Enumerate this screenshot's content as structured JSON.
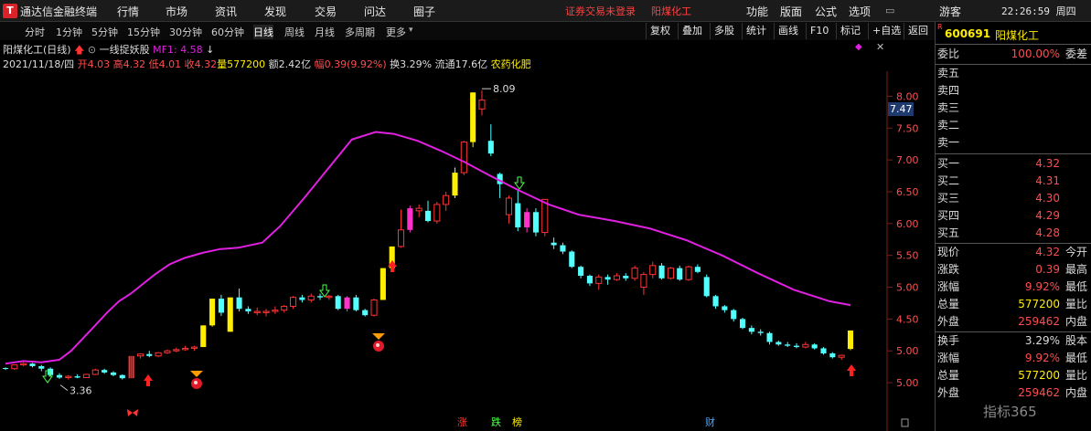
{
  "topbar": {
    "logo": "T",
    "app_title": "通达信金融终端",
    "menu": [
      "行情",
      "市场",
      "资讯",
      "发现",
      "交易",
      "问达",
      "圈子"
    ],
    "notice": "证券交易未登录",
    "notice_stock": "阳煤化工",
    "right_menu": [
      "功能",
      "版面",
      "公式",
      "选项"
    ],
    "guest": "游客",
    "clock": "22:26:59 周四"
  },
  "periods": [
    "分时",
    "1分钟",
    "5分钟",
    "15分钟",
    "30分钟",
    "60分钟",
    "日线",
    "周线",
    "月线",
    "多周期",
    "更多"
  ],
  "active_period": "日线",
  "toolbar": [
    "复权",
    "叠加",
    "多股",
    "统计",
    "画线",
    "F10",
    "标记",
    "+自选",
    "返回"
  ],
  "title": {
    "name": "阳煤化工(日线)",
    "indicator": "一线捉妖股",
    "mf_label": "MF1: 4.58"
  },
  "info": {
    "date": "2021/11/18/四",
    "open": "开4.03",
    "high": "高4.32",
    "low": "低4.01",
    "close": "收4.32",
    "vol_label": "量",
    "vol": "577200",
    "amount": "额2.42亿",
    "change_label": "幅",
    "change": "0.39(9.92%)",
    "turnover": "换3.29%",
    "float": "流通17.6亿",
    "sector": "农药化肥"
  },
  "chart_data": {
    "type": "candlestick",
    "y_ticks": [
      "8.00",
      "7.50",
      "7.00",
      "6.50",
      "6.00",
      "5.50",
      "5.00",
      "4.50",
      "5.00",
      "5.00"
    ],
    "ylim": [
      3.2,
      8.25
    ],
    "high_label": "8.09",
    "low_label": "3.36",
    "price_box": "7.47",
    "bottom_markers": [
      "涨",
      "跌",
      "榜",
      "财"
    ],
    "colors": {
      "up": "#ff3333",
      "down": "#54ffff",
      "limit": "#ffee00",
      "strong": "#ff33cc",
      "ma": "#e020e0"
    },
    "candles": [
      [
        3.72,
        3.74,
        3.7,
        3.73,
        "d"
      ],
      [
        3.72,
        3.79,
        3.7,
        3.78,
        "u"
      ],
      [
        3.78,
        3.82,
        3.76,
        3.8,
        "u"
      ],
      [
        3.8,
        3.81,
        3.74,
        3.76,
        "d"
      ],
      [
        3.76,
        3.78,
        3.68,
        3.72,
        "d"
      ],
      [
        3.72,
        3.74,
        3.6,
        3.62,
        "d"
      ],
      [
        3.62,
        3.65,
        3.56,
        3.58,
        "d"
      ],
      [
        3.58,
        3.62,
        3.55,
        3.6,
        "u"
      ],
      [
        3.6,
        3.63,
        3.57,
        3.58,
        "d"
      ],
      [
        3.58,
        3.64,
        3.58,
        3.63,
        "u"
      ],
      [
        3.63,
        3.72,
        3.62,
        3.7,
        "u"
      ],
      [
        3.7,
        3.72,
        3.64,
        3.66,
        "d"
      ],
      [
        3.66,
        3.68,
        3.6,
        3.62,
        "d"
      ],
      [
        3.62,
        3.63,
        3.55,
        3.57,
        "d"
      ],
      [
        3.57,
        3.92,
        3.57,
        3.92,
        "r"
      ],
      [
        3.92,
        3.96,
        3.88,
        3.95,
        "u"
      ],
      [
        3.95,
        4.0,
        3.9,
        3.92,
        "d"
      ],
      [
        3.92,
        3.98,
        3.9,
        3.97,
        "u"
      ],
      [
        3.97,
        4.02,
        3.95,
        4.0,
        "u"
      ],
      [
        4.0,
        4.05,
        3.98,
        4.02,
        "u"
      ],
      [
        4.02,
        4.08,
        4.0,
        4.04,
        "u"
      ],
      [
        4.04,
        4.08,
        4.0,
        4.06,
        "u"
      ],
      [
        4.06,
        4.4,
        4.06,
        4.4,
        "y"
      ],
      [
        4.4,
        4.82,
        4.38,
        4.82,
        "y"
      ],
      [
        4.82,
        4.88,
        4.55,
        4.6,
        "d"
      ],
      [
        4.3,
        4.84,
        4.3,
        4.84,
        "y"
      ],
      [
        4.84,
        4.98,
        4.62,
        4.66,
        "d"
      ],
      [
        4.66,
        4.7,
        4.58,
        4.62,
        "d"
      ],
      [
        4.62,
        4.68,
        4.56,
        4.6,
        "u"
      ],
      [
        4.6,
        4.66,
        4.54,
        4.62,
        "u"
      ],
      [
        4.62,
        4.7,
        4.58,
        4.64,
        "u"
      ],
      [
        4.64,
        4.72,
        4.6,
        4.7,
        "u"
      ],
      [
        4.7,
        4.86,
        4.66,
        4.84,
        "u"
      ],
      [
        4.84,
        4.88,
        4.76,
        4.8,
        "d"
      ],
      [
        4.8,
        4.9,
        4.76,
        4.86,
        "u"
      ],
      [
        4.86,
        4.9,
        4.8,
        4.84,
        "d"
      ],
      [
        4.84,
        4.88,
        4.8,
        4.86,
        "u"
      ],
      [
        4.86,
        4.88,
        4.64,
        4.66,
        "d"
      ],
      [
        4.66,
        4.86,
        4.62,
        4.84,
        "p"
      ],
      [
        4.84,
        4.88,
        4.62,
        4.64,
        "d"
      ],
      [
        4.64,
        4.66,
        4.54,
        4.56,
        "d"
      ],
      [
        4.56,
        4.82,
        4.54,
        4.8,
        "u"
      ],
      [
        4.8,
        5.3,
        4.8,
        5.3,
        "y"
      ],
      [
        5.3,
        5.64,
        5.3,
        5.64,
        "y"
      ],
      [
        5.64,
        6.22,
        5.62,
        5.9,
        "u"
      ],
      [
        5.9,
        6.28,
        5.86,
        6.24,
        "p"
      ],
      [
        6.24,
        6.3,
        6.1,
        6.2,
        "u"
      ],
      [
        6.2,
        6.36,
        6.02,
        6.04,
        "d"
      ],
      [
        6.04,
        6.34,
        6.0,
        6.3,
        "u"
      ],
      [
        6.3,
        6.5,
        6.2,
        6.44,
        "u"
      ],
      [
        6.44,
        6.88,
        6.4,
        6.8,
        "y"
      ],
      [
        6.8,
        7.3,
        6.76,
        7.28,
        "u"
      ],
      [
        7.28,
        8.06,
        7.2,
        8.06,
        "y"
      ],
      [
        7.94,
        8.09,
        7.7,
        7.8,
        "u"
      ],
      [
        7.3,
        7.56,
        7.06,
        7.1,
        "d"
      ],
      [
        6.78,
        6.8,
        6.4,
        6.62,
        "d"
      ],
      [
        6.4,
        6.44,
        6.0,
        6.14,
        "u"
      ],
      [
        6.32,
        6.52,
        5.88,
        5.94,
        "d"
      ],
      [
        5.94,
        6.24,
        5.86,
        6.18,
        "p"
      ],
      [
        6.18,
        6.24,
        5.8,
        5.86,
        "d"
      ],
      [
        5.86,
        6.38,
        5.8,
        6.38,
        "u"
      ],
      [
        5.7,
        5.78,
        5.6,
        5.66,
        "d"
      ],
      [
        5.66,
        5.7,
        5.52,
        5.56,
        "d"
      ],
      [
        5.56,
        5.58,
        5.3,
        5.32,
        "d"
      ],
      [
        5.32,
        5.34,
        5.14,
        5.18,
        "d"
      ],
      [
        5.18,
        5.2,
        5.02,
        5.06,
        "d"
      ],
      [
        5.06,
        5.2,
        4.96,
        5.16,
        "u"
      ],
      [
        5.16,
        5.2,
        5.04,
        5.12,
        "d"
      ],
      [
        5.12,
        5.22,
        5.1,
        5.18,
        "u"
      ],
      [
        5.18,
        5.22,
        5.1,
        5.14,
        "d"
      ],
      [
        5.14,
        5.34,
        5.1,
        5.3,
        "u"
      ],
      [
        5.0,
        5.24,
        4.88,
        5.2,
        "u"
      ],
      [
        5.2,
        5.4,
        5.14,
        5.34,
        "u"
      ],
      [
        5.34,
        5.38,
        5.12,
        5.14,
        "d"
      ],
      [
        5.14,
        5.32,
        5.12,
        5.3,
        "u"
      ],
      [
        5.3,
        5.34,
        5.1,
        5.12,
        "d"
      ],
      [
        5.12,
        5.34,
        5.1,
        5.32,
        "u"
      ],
      [
        5.32,
        5.36,
        5.22,
        5.24,
        "d"
      ],
      [
        5.16,
        5.2,
        4.84,
        4.86,
        "d"
      ],
      [
        4.86,
        4.88,
        4.66,
        4.7,
        "d"
      ],
      [
        4.7,
        4.72,
        4.6,
        4.64,
        "d"
      ],
      [
        4.64,
        4.66,
        4.46,
        4.5,
        "d"
      ],
      [
        4.5,
        4.52,
        4.34,
        4.36,
        "d"
      ],
      [
        4.36,
        4.4,
        4.26,
        4.3,
        "d"
      ],
      [
        4.3,
        4.34,
        4.24,
        4.28,
        "d"
      ],
      [
        4.28,
        4.3,
        4.1,
        4.14,
        "d"
      ],
      [
        4.14,
        4.16,
        4.08,
        4.1,
        "d"
      ],
      [
        4.1,
        4.14,
        4.06,
        4.08,
        "d"
      ],
      [
        4.08,
        4.12,
        4.04,
        4.06,
        "d"
      ],
      [
        4.06,
        4.14,
        4.04,
        4.1,
        "u"
      ],
      [
        4.1,
        4.12,
        4.02,
        4.04,
        "d"
      ],
      [
        4.04,
        4.06,
        3.94,
        3.96,
        "d"
      ],
      [
        3.96,
        3.98,
        3.88,
        3.9,
        "d"
      ],
      [
        3.9,
        3.94,
        3.86,
        3.93,
        "u"
      ],
      [
        4.03,
        4.32,
        4.01,
        4.32,
        "y"
      ]
    ],
    "ma_line": [
      [
        0,
        3.8
      ],
      [
        6,
        3.84
      ],
      [
        12,
        3.82
      ],
      [
        18,
        3.86
      ],
      [
        22,
        4.0
      ],
      [
        26,
        4.2
      ],
      [
        30,
        4.4
      ],
      [
        34,
        4.6
      ],
      [
        38,
        4.78
      ],
      [
        42,
        4.9
      ],
      [
        46,
        5.05
      ],
      [
        50,
        5.2
      ],
      [
        55,
        5.36
      ],
      [
        60,
        5.46
      ],
      [
        66,
        5.54
      ],
      [
        72,
        5.6
      ],
      [
        78,
        5.62
      ],
      [
        86,
        5.7
      ],
      [
        92,
        5.96
      ],
      [
        100,
        6.4
      ],
      [
        108,
        6.86
      ],
      [
        116,
        7.32
      ],
      [
        124,
        7.44
      ],
      [
        130,
        7.41
      ],
      [
        138,
        7.3
      ],
      [
        146,
        7.14
      ],
      [
        154,
        6.96
      ],
      [
        162,
        6.76
      ],
      [
        172,
        6.52
      ],
      [
        182,
        6.3
      ],
      [
        192,
        6.14
      ],
      [
        204,
        6.04
      ],
      [
        216,
        5.92
      ],
      [
        228,
        5.74
      ],
      [
        240,
        5.5
      ],
      [
        252,
        5.22
      ],
      [
        264,
        4.96
      ],
      [
        276,
        4.78
      ],
      [
        283,
        4.72
      ]
    ]
  },
  "quote": {
    "code": "600691",
    "name": "阳煤化工",
    "weibi": "委比",
    "weibi_val": "100.00%",
    "weicha": "委差",
    "sell": [
      "卖五",
      "卖四",
      "卖三",
      "卖二",
      "卖一"
    ],
    "buy": [
      {
        "label": "买一",
        "val": "4.32"
      },
      {
        "label": "买二",
        "val": "4.31"
      },
      {
        "label": "买三",
        "val": "4.30"
      },
      {
        "label": "买四",
        "val": "4.29"
      },
      {
        "label": "买五",
        "val": "4.28"
      }
    ],
    "stats": [
      {
        "label": "现价",
        "val": "4.32",
        "label2": "今开"
      },
      {
        "label": "涨跌",
        "val": "0.39",
        "label2": "最高"
      },
      {
        "label": "涨幅",
        "val": "9.92%",
        "label2": "最低"
      },
      {
        "label": "总量",
        "val": "577200",
        "label2": "量比"
      },
      {
        "label": "外盘",
        "val": "259462",
        "label2": "内盘"
      },
      {
        "label": "换手",
        "val": "3.29%",
        "label2": "股本"
      },
      {
        "label": "涨幅",
        "val": "9.92%",
        "label2": "最低"
      },
      {
        "label": "总量",
        "val": "577200",
        "label2": "量比"
      },
      {
        "label": "外盘",
        "val": "259462",
        "label2": "内盘"
      }
    ],
    "watermark": "指标365"
  }
}
